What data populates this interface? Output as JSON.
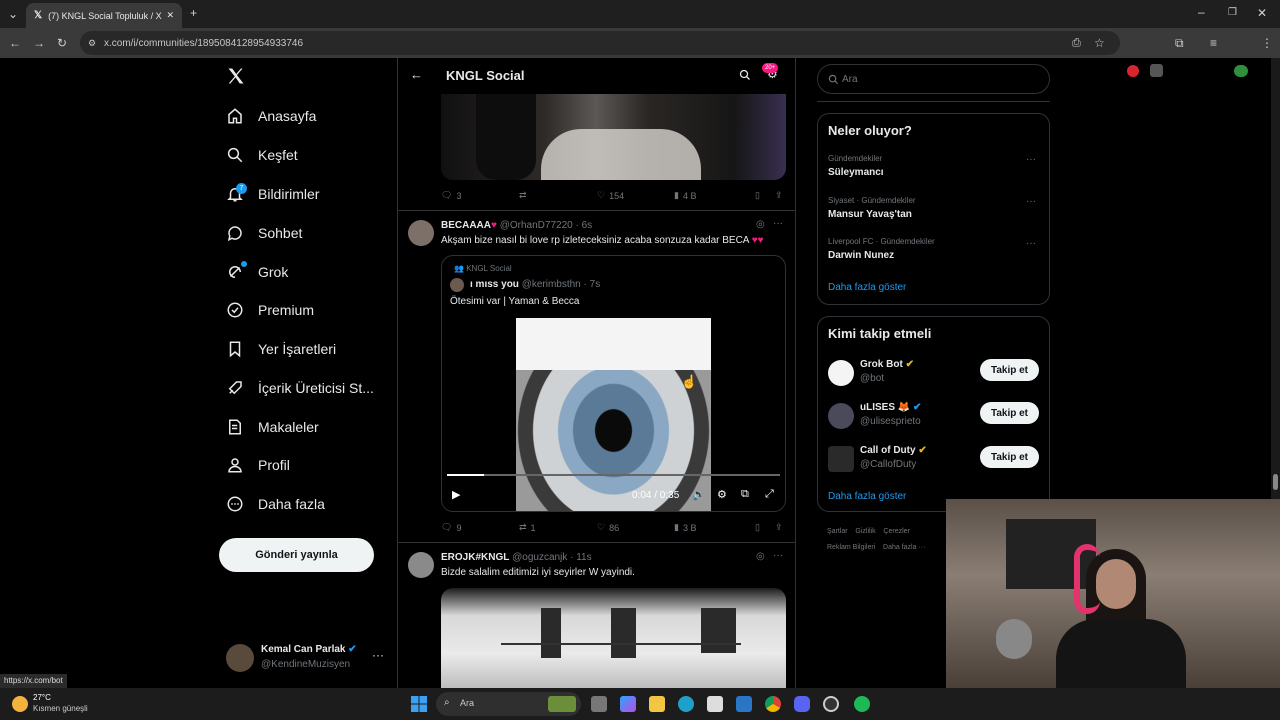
{
  "browser": {
    "tab_title": "(7) KNGL Social Topluluk / X",
    "url": "x.com/i/communities/1895084128954933746",
    "status_url": "https://x.com/bot"
  },
  "nav": {
    "items": [
      {
        "label": "Anasayfa",
        "icon": "home-icon"
      },
      {
        "label": "Keşfet",
        "icon": "search-icon"
      },
      {
        "label": "Bildirimler",
        "icon": "bell-icon",
        "badge": "7"
      },
      {
        "label": "Sohbet",
        "icon": "chat-icon"
      },
      {
        "label": "Grok",
        "icon": "grok-icon"
      },
      {
        "label": "Premium",
        "icon": "premium-icon"
      },
      {
        "label": "Yer İşaretleri",
        "icon": "bookmark-icon"
      },
      {
        "label": "İçerik Üreticisi St...",
        "icon": "rocket-icon"
      },
      {
        "label": "Makaleler",
        "icon": "article-icon"
      },
      {
        "label": "Profil",
        "icon": "profile-icon"
      },
      {
        "label": "Daha fazla",
        "icon": "more-icon"
      }
    ],
    "post_button": "Gönderi yayınla",
    "account": {
      "name": "Kemal Can Parlak",
      "handle": "@KendineMuzisyen"
    }
  },
  "header": {
    "title": "KNGL Social",
    "badge": "20+"
  },
  "tweets": [
    {
      "replies": "3",
      "retweets": "",
      "likes": "154",
      "views": "4 B"
    },
    {
      "name": "BECAAAA",
      "handle": "@OrhanD77220",
      "time": "6s",
      "text": "Akşam bize nasıl bi love rp izleteceksiniz acaba sonzuza kadar BECA",
      "quote": {
        "community": "KNGL Social",
        "name": "ı mıss you",
        "handle": "@kerimbsthn",
        "time": "7s",
        "text": "Ötesimi var | Yaman & Becca",
        "video_time": "0:04 / 0:35",
        "progress": 0.11
      },
      "replies": "9",
      "retweets": "1",
      "likes": "86",
      "views": "3 B"
    },
    {
      "name": "EROJK#KNGL",
      "handle": "@oguzcanjk",
      "time": "11s",
      "text": "Bizde salalim editimizi iyi seyirler W yayindi."
    }
  ],
  "search": {
    "placeholder": "Ara"
  },
  "trends": {
    "title": "Neler oluyor?",
    "items": [
      {
        "context": "Gündemdekiler",
        "name": "Süleymancı"
      },
      {
        "context": "Siyaset · Gündemdekiler",
        "name": "Mansur Yavaş'tan"
      },
      {
        "context": "Liverpool FC · Gündemdekiler",
        "name": "Darwin Nunez"
      }
    ],
    "more": "Daha fazla göster"
  },
  "who_to_follow": {
    "title": "Kimi takip etmeli",
    "items": [
      {
        "name": "Grok Bot",
        "handle": "@bot",
        "button": "Takip et"
      },
      {
        "name": "uLISES 🦊",
        "handle": "@ulisesprieto",
        "button": "Takip et"
      },
      {
        "name": "Call of Duty",
        "handle": "@CallofDuty",
        "button": "Takip et"
      }
    ],
    "more": "Daha fazla göster"
  },
  "footer_links": [
    "Şartlar",
    "Gizlilik",
    "Çerezler",
    "Reklam Bilgileri",
    "Daha fazla ···"
  ],
  "taskbar": {
    "weather_temp": "27°C",
    "weather_desc": "Kısmen güneşli",
    "search": "Ara"
  },
  "colors": {
    "accent": "#1d9bf0",
    "like_red": "#f91880",
    "badge_pink": "#f91880"
  }
}
